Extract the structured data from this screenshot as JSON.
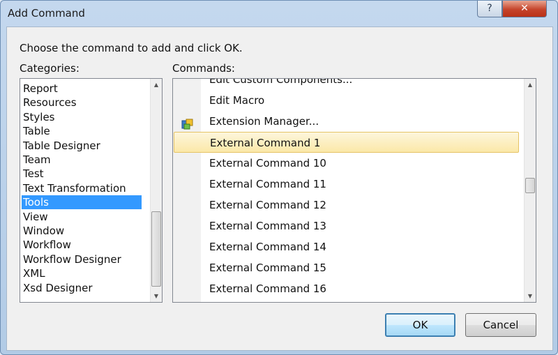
{
  "window": {
    "title": "Add Command",
    "help_symbol": "?",
    "close_symbol": "✕"
  },
  "prompt": "Choose the command to add and click OK.",
  "categories": {
    "label": "Categories:",
    "items": [
      "Report",
      "Resources",
      "Styles",
      "Table",
      "Table Designer",
      "Team",
      "Test",
      "Text Transformation",
      "Tools",
      "View",
      "Window",
      "Workflow",
      "Workflow Designer",
      "XML",
      "Xsd Designer"
    ],
    "selected": "Tools"
  },
  "commands": {
    "label": "Commands:",
    "partial_top": "Edit Custom Components...",
    "items": [
      "Edit Macro",
      "Extension Manager...",
      "External Command 1",
      "External Command 10",
      "External Command 11",
      "External Command 12",
      "External Command 13",
      "External Command 14",
      "External Command 15",
      "External Command 16"
    ],
    "selected": "External Command 1",
    "icons": {
      "Extension Manager...": "extension-manager-icon"
    }
  },
  "buttons": {
    "ok": "OK",
    "cancel": "Cancel"
  }
}
